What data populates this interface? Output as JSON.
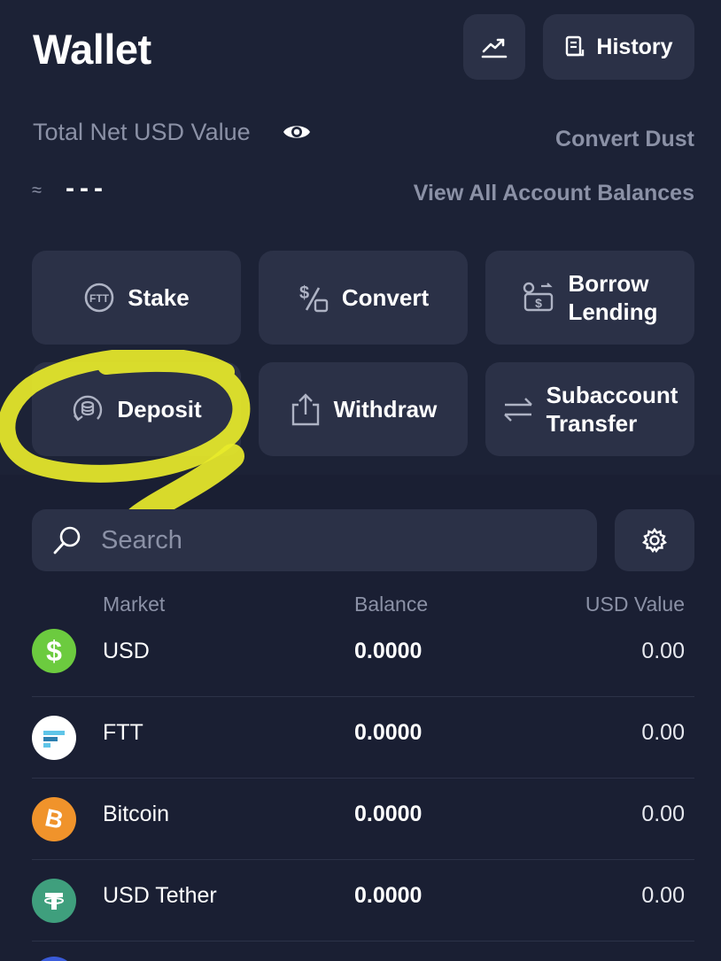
{
  "header": {
    "title": "Wallet",
    "chart_icon": "trending-up-icon",
    "history_icon": "receipt-icon",
    "history_label": "History"
  },
  "summary": {
    "net_label": "Total Net USD Value",
    "eye_icon": "eye-icon",
    "convert_dust": "Convert Dust",
    "approx_symbol": "≈",
    "net_value": "---",
    "view_all": "View All Account Balances"
  },
  "actions": [
    {
      "label": "Stake",
      "icon": "ftt-coin-icon"
    },
    {
      "label": "Convert",
      "icon": "dollar-percent-icon"
    },
    {
      "label": "Borrow\nLending",
      "icon": "lending-icon"
    },
    {
      "label": "Deposit",
      "icon": "deposit-coins-icon"
    },
    {
      "label": "Withdraw",
      "icon": "upload-icon"
    },
    {
      "label": "Subaccount\nTransfer",
      "icon": "transfer-arrows-icon"
    }
  ],
  "search": {
    "placeholder": "Search",
    "icon": "search-icon",
    "settings_icon": "gear-icon"
  },
  "table": {
    "headers": [
      "Market",
      "Balance",
      "USD Value"
    ],
    "rows": [
      {
        "market": "USD",
        "balance": "0.0000",
        "usd_value": "0.00",
        "icon": "usd-coin-icon",
        "color": "#6ccb3f"
      },
      {
        "market": "FTT",
        "balance": "0.0000",
        "usd_value": "0.00",
        "icon": "ftt-coin-icon",
        "color": "#ffffff"
      },
      {
        "market": "Bitcoin",
        "balance": "0.0000",
        "usd_value": "0.00",
        "icon": "bitcoin-icon",
        "color": "#f0932b"
      },
      {
        "market": "USD Tether",
        "balance": "0.0000",
        "usd_value": "0.00",
        "icon": "tether-icon",
        "color": "#3f9f7d"
      }
    ]
  },
  "annotation": {
    "color": "#e8ea2a"
  }
}
